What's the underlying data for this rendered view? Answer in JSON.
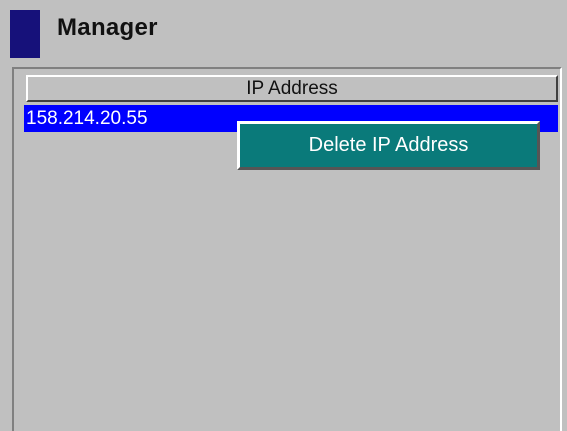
{
  "window": {
    "title": "Manager"
  },
  "table": {
    "columns": [
      "IP Address"
    ],
    "rows": [
      {
        "ip": "158.214.20.55",
        "selected": true
      }
    ]
  },
  "context_menu": {
    "items": [
      "Delete IP Address"
    ]
  },
  "colors": {
    "title_accent": "#16117a",
    "selection": "#0000ff",
    "menu_highlight": "#0a7a7a",
    "background": "#c0c0c0"
  }
}
